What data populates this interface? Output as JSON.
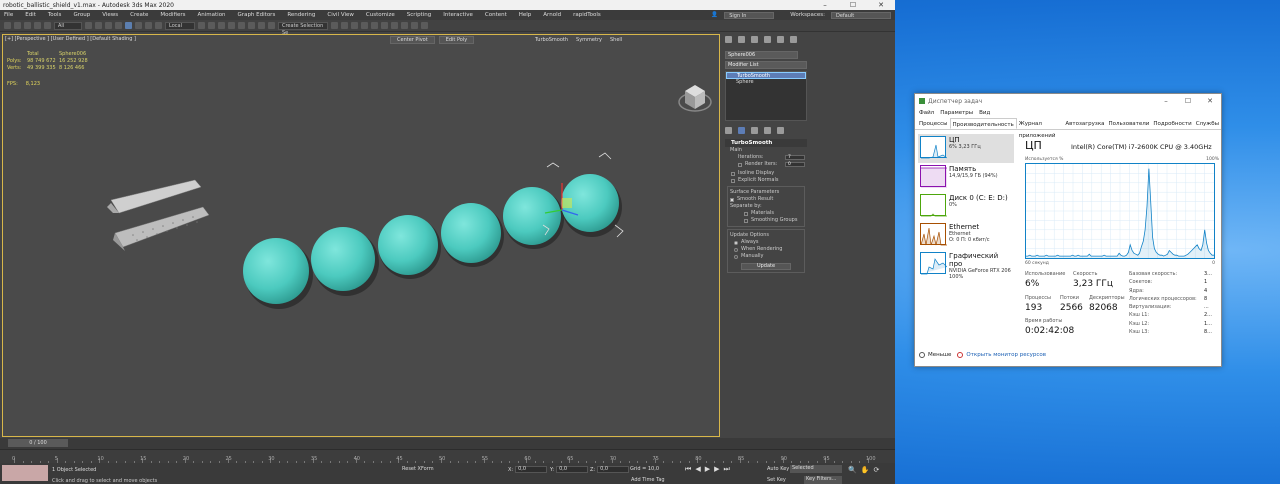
{
  "max": {
    "title": "robotic_ballistic_shield_v1.max - Autodesk 3ds Max 2020",
    "menu": [
      "File",
      "Edit",
      "Tools",
      "Group",
      "Views",
      "Create",
      "Modifiers",
      "Animation",
      "Graph Editors",
      "Rendering",
      "Civil View",
      "Customize",
      "Scripting",
      "Interactive",
      "Content",
      "Help",
      "Arnold",
      "rapidTools"
    ],
    "sign_in": "Sign In",
    "workspaces_label": "Workspaces:",
    "workspace_value": "Default",
    "toolbar": {
      "filter": "All",
      "coord_system": "Local",
      "selection_set": "Create Selection Se"
    },
    "viewport": {
      "label": "[+] [Perspective ] [User Defined ] [Default Shading ]",
      "stats": {
        "header_total": "Total",
        "header_object": "Sphere006",
        "polys_label": "Polys:",
        "polys_total": "98 749 672",
        "polys_object": "16 252 928",
        "verts_label": "Verts:",
        "verts_total": "49 399 335",
        "verts_object": "8 126 466",
        "fps_label": "FPS:",
        "fps_value": "8,123"
      },
      "buttons": [
        "Center Pivot",
        "Edit Poly"
      ],
      "modifiers": [
        "TurboSmooth",
        "Symmetry",
        "Shell"
      ]
    },
    "command_panel": {
      "object_name": "Sphere006",
      "modifier_list": "Modifier List",
      "stack": [
        "TurboSmooth",
        "Sphere"
      ],
      "rollout": "TurboSmooth",
      "main": "Main",
      "iterations_label": "Iterations:",
      "iterations_value": "7",
      "render_iters_label": "Render Iters:",
      "render_iters_value": "0",
      "isoline": "Isoline Display",
      "explicit": "Explicit Normals",
      "surface_params": "Surface Parameters",
      "smooth_result": "Smooth Result",
      "separate_by": "Separate by:",
      "materials": "Materials",
      "smoothing_groups": "Smoothing Groups",
      "update_options": "Update Options",
      "always": "Always",
      "when_rendering": "When Rendering",
      "manually": "Manually",
      "update": "Update"
    },
    "timeline": {
      "frame": "0 / 100",
      "ticks": [
        "0",
        "5",
        "10",
        "15",
        "20",
        "25",
        "30",
        "35",
        "40",
        "45",
        "50",
        "55",
        "60",
        "65",
        "70",
        "75",
        "80",
        "85",
        "90",
        "95",
        "100"
      ]
    },
    "status": {
      "selected": "1 Object Selected",
      "hint": "Click and drag to select and move objects",
      "reset_xform": "Reset XForm",
      "x_label": "X:",
      "x_value": "0,0",
      "y_label": "Y:",
      "y_value": "0,0",
      "z_label": "Z:",
      "z_value": "0,0",
      "grid": "Grid = 10,0",
      "add_time_tag": "Add Time Tag",
      "auto_key": "Auto Key",
      "set_key": "Set Key",
      "selected_drop": "Selected",
      "key_filters": "Key Filters..."
    }
  },
  "taskmgr": {
    "title": "Диспетчер задач",
    "menu": [
      "Файл",
      "Параметры",
      "Вид"
    ],
    "tabs": [
      "Процессы",
      "Производительность",
      "Журнал приложений",
      "Автозагрузка",
      "Пользователи",
      "Подробности",
      "Службы"
    ],
    "side": [
      {
        "name": "ЦП",
        "sub1": "6% 3,23 ГГц",
        "sub2": ""
      },
      {
        "name": "Память",
        "sub1": "14,9/15,9 ГБ (94%)",
        "sub2": ""
      },
      {
        "name": "Диск 0 (C: E: D:)",
        "sub1": "0%",
        "sub2": ""
      },
      {
        "name": "Ethernet",
        "sub1": "Ethernet",
        "sub2": "О: 0 П: 0 кбит/с"
      },
      {
        "name": "Графический про",
        "sub1": "NVIDIA GeForce RTX 206",
        "sub2": "100%"
      }
    ],
    "cpu": {
      "heading": "ЦП",
      "model": "Intel(R) Core(TM) i7-2600K CPU @ 3.40GHz",
      "usage_label": "Используется %",
      "max_pct": "100%",
      "seconds": "60 секунд",
      "zero": "0",
      "usage_title": "Использование",
      "usage_value": "6%",
      "speed_title": "Скорость",
      "speed_value": "3,23 ГГц",
      "procs_title": "Процессы",
      "procs_value": "193",
      "threads_title": "Потоки",
      "threads_value": "2566",
      "handles_title": "Дескрипторы",
      "handles_value": "82068",
      "uptime_title": "Время работы",
      "uptime_value": "0:02:42:08",
      "specs": [
        {
          "k": "Базовая скорость:",
          "v": "3..."
        },
        {
          "k": "Сокетов:",
          "v": "1"
        },
        {
          "k": "Ядра:",
          "v": "4"
        },
        {
          "k": "Логических процессоров:",
          "v": "8"
        },
        {
          "k": "Виртуализация:",
          "v": "..."
        },
        {
          "k": "Кэш L1:",
          "v": "2..."
        },
        {
          "k": "Кэш L2:",
          "v": "1..."
        },
        {
          "k": "Кэш L3:",
          "v": "8..."
        }
      ],
      "graph": [
        2,
        2,
        3,
        2,
        2,
        2,
        3,
        2,
        2,
        2,
        2,
        3,
        2,
        2,
        2,
        2,
        2,
        3,
        2,
        2,
        2,
        2,
        2,
        2,
        2,
        3,
        2,
        2,
        3,
        2,
        2,
        2,
        2,
        2,
        4,
        2,
        2,
        2,
        2,
        2,
        2,
        2,
        3,
        2,
        2,
        2,
        2,
        2,
        2,
        2,
        5,
        3,
        2,
        2,
        3,
        6,
        14,
        8,
        5,
        4,
        3,
        5,
        12,
        18,
        30,
        55,
        95,
        60,
        22,
        10,
        6,
        4,
        3,
        3,
        2,
        3,
        4,
        8,
        6,
        4,
        3,
        3,
        2,
        2,
        2,
        2,
        3,
        4,
        6,
        8,
        10,
        12,
        14,
        10,
        8,
        14,
        30,
        16,
        8,
        5,
        3,
        3
      ]
    },
    "footer": {
      "less": "Меньше",
      "monitor": "Открыть монитор ресурсов"
    }
  }
}
